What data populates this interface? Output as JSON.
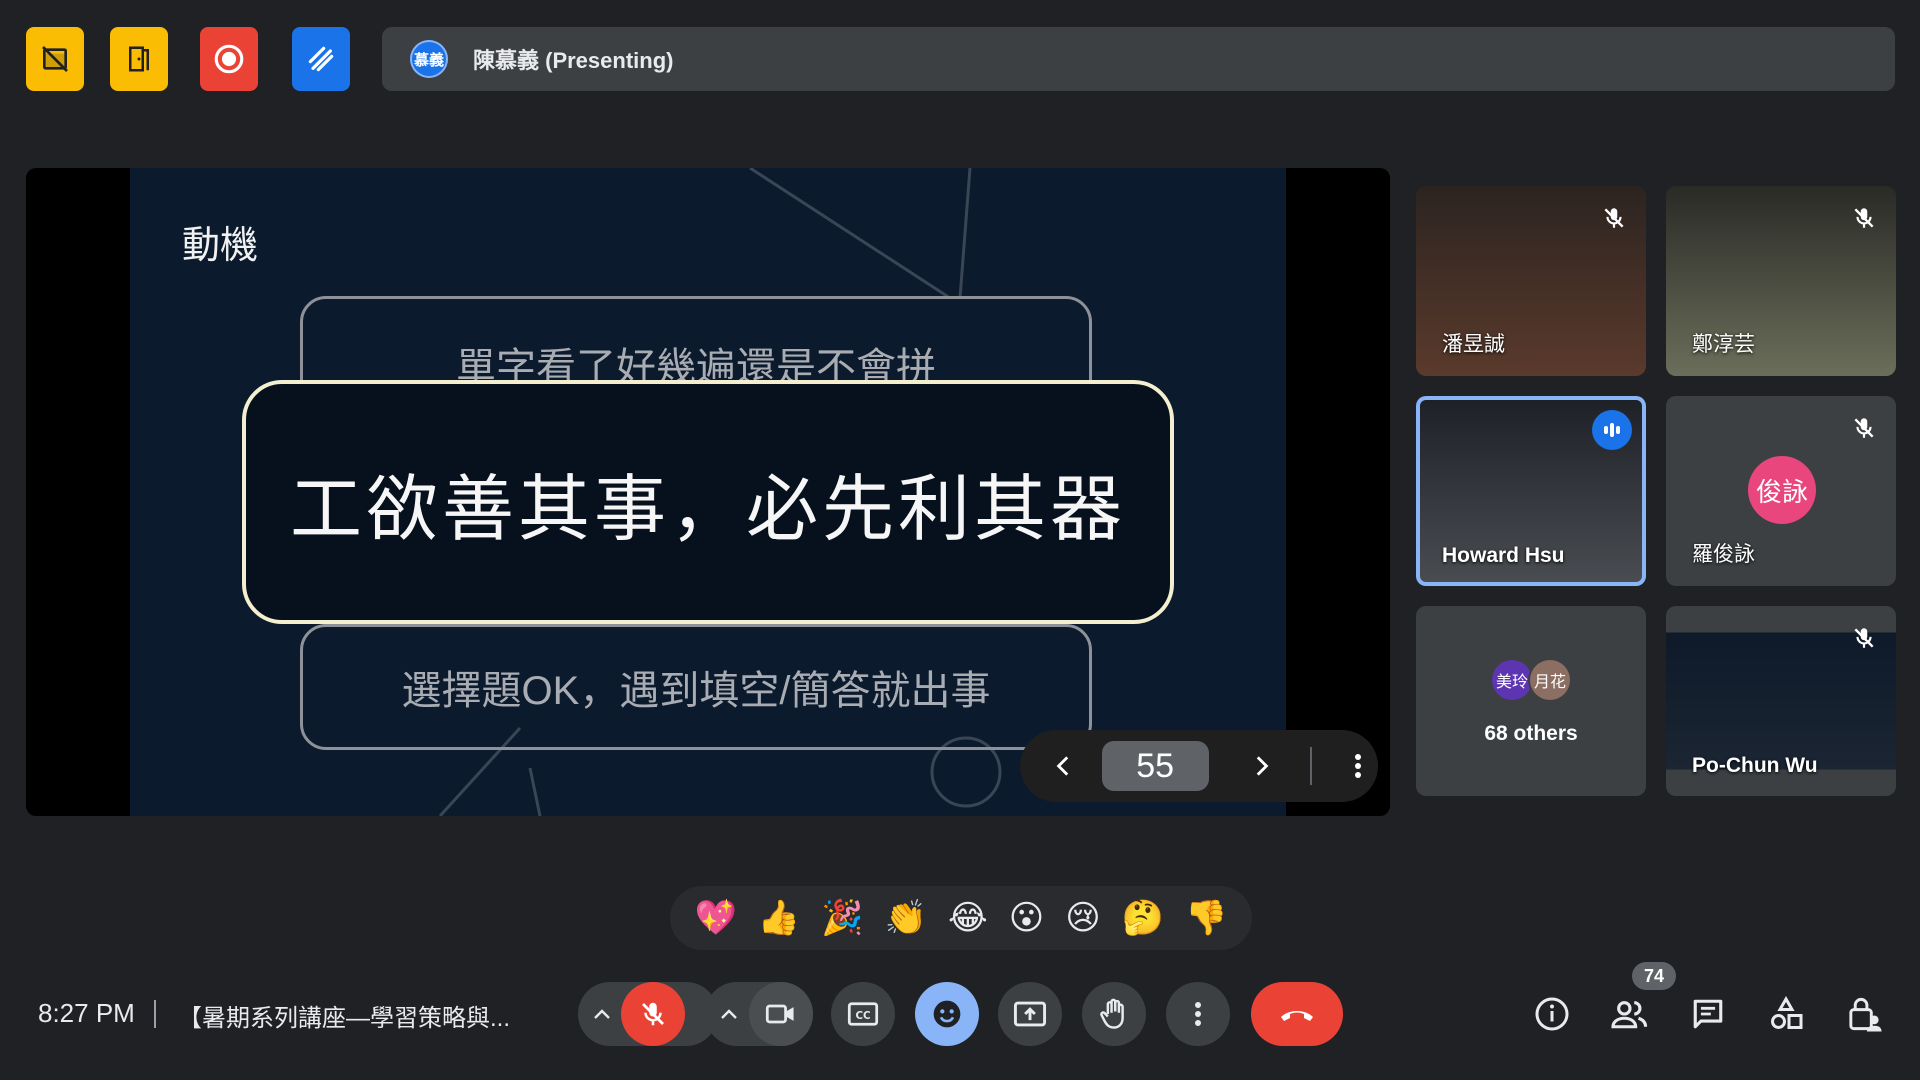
{
  "top_bar": {
    "presenter_avatar_text": "慕義",
    "presenter_label": "陳慕義 (Presenting)"
  },
  "slide": {
    "title": "動機",
    "card_top": "單字看了好幾遍還是不會拼",
    "card_main": "工欲善其事，必先利其器",
    "card_bottom": "選擇題OK，遇到填空/簡答就出事",
    "page_number": "55"
  },
  "participants": [
    {
      "name": "潘昱誠",
      "muted": true
    },
    {
      "name": "鄭淳芸",
      "muted": true
    },
    {
      "name": "Howard Hsu",
      "speaking": true
    },
    {
      "name": "羅俊詠",
      "muted": true,
      "initials": "俊詠"
    },
    {
      "name": "68 others",
      "avatars": [
        "美玲",
        "月花"
      ]
    },
    {
      "name": "Po-Chun Wu",
      "muted": true
    }
  ],
  "reactions": [
    "💖",
    "👍",
    "🎉",
    "👏",
    "😂",
    "😮",
    "😢",
    "🤔",
    "👎"
  ],
  "bottom_bar": {
    "time": "8:27 PM",
    "meeting_title": "【暑期系列講座—學習策略與...",
    "participant_count": "74"
  },
  "colors": {
    "background": "#202124",
    "accent_blue": "#8ab4f8",
    "danger_red": "#ea4335",
    "tool_yellow": "#fbbc04",
    "tool_blue": "#1a73e8"
  }
}
